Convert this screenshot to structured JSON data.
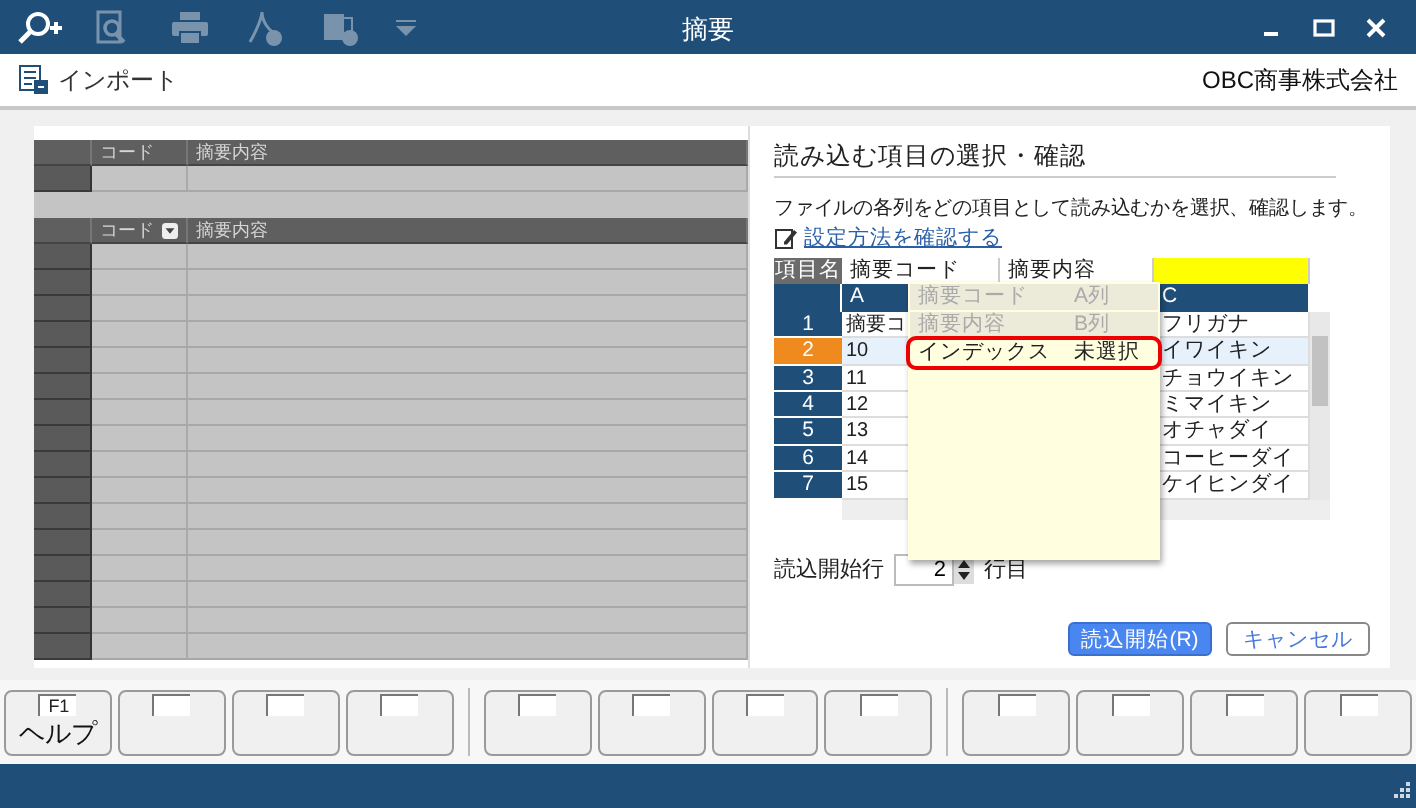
{
  "window": {
    "title": "摘要"
  },
  "toolbar": [
    {
      "kind": "zoom",
      "disabled": false
    },
    {
      "kind": "preview",
      "disabled": true
    },
    {
      "kind": "print",
      "disabled": true
    },
    {
      "kind": "pdf",
      "disabled": true
    },
    {
      "kind": "excel",
      "disabled": true
    },
    {
      "kind": "more",
      "disabled": true
    }
  ],
  "header": {
    "command": "インポート",
    "company": "OBC商事株式会社"
  },
  "left_grids": [
    {
      "columns": [
        {
          "label": "コード",
          "dropdown": false
        },
        {
          "label": "摘要内容",
          "dropdown": false
        }
      ]
    },
    {
      "columns": [
        {
          "label": "コード",
          "dropdown": true
        },
        {
          "label": "摘要内容",
          "dropdown": false
        }
      ]
    }
  ],
  "panel": {
    "title": "読み込む項目の選択・確認",
    "description": "ファイルの各列をどの項目として読み込むかを選択、確認します。",
    "help_link": "設定方法を確認する",
    "mapping": {
      "corner": "項目名",
      "row_numbers": [
        {
          "label": "1",
          "selected": false
        },
        {
          "label": "2",
          "selected": true
        },
        {
          "label": "3",
          "selected": false
        },
        {
          "label": "4",
          "selected": false
        },
        {
          "label": "5",
          "selected": false
        },
        {
          "label": "6",
          "selected": false
        },
        {
          "label": "7",
          "selected": false
        }
      ],
      "columns": [
        {
          "field": "摘要コード",
          "highlighted": false,
          "letter": "A",
          "cells": [
            "摘要コ",
            "10",
            "11",
            "12",
            "13",
            "14",
            "15"
          ]
        },
        {
          "field": "摘要内容",
          "highlighted": false
        },
        {
          "highlighted": true,
          "letter": "C",
          "cells": [
            "フリガナ",
            "イワイキン",
            "チョウイキン",
            "ミマイキン",
            "オチャダイ",
            "コーヒーダイ",
            "ケイヒンダイ"
          ]
        }
      ]
    },
    "dropdown": [
      {
        "name": "摘要コード",
        "column": "A列",
        "disabled": true,
        "highlighted": false
      },
      {
        "name": "摘要内容",
        "column": "B列",
        "disabled": true,
        "highlighted": false
      },
      {
        "name": "インデックス",
        "column": "未選択",
        "disabled": false,
        "highlighted": true
      }
    ],
    "start_row": {
      "label": "読込開始行",
      "value": "2",
      "unit": "行目"
    },
    "buttons": [
      {
        "label": "読込開始(R)",
        "kind": "primary"
      },
      {
        "label": "キャンセル",
        "kind": "secondary"
      }
    ]
  },
  "function_keys": [
    {
      "kind": "labeled",
      "key": "F1",
      "label": "ヘルプ"
    },
    {
      "kind": "blank"
    },
    {
      "kind": "blank"
    },
    {
      "kind": "blank"
    },
    {
      "kind": "blank"
    },
    {
      "kind": "blank"
    },
    {
      "kind": "blank"
    },
    {
      "kind": "blank"
    },
    {
      "kind": "blank"
    },
    {
      "kind": "blank"
    },
    {
      "kind": "blank"
    },
    {
      "kind": "blank"
    }
  ]
}
